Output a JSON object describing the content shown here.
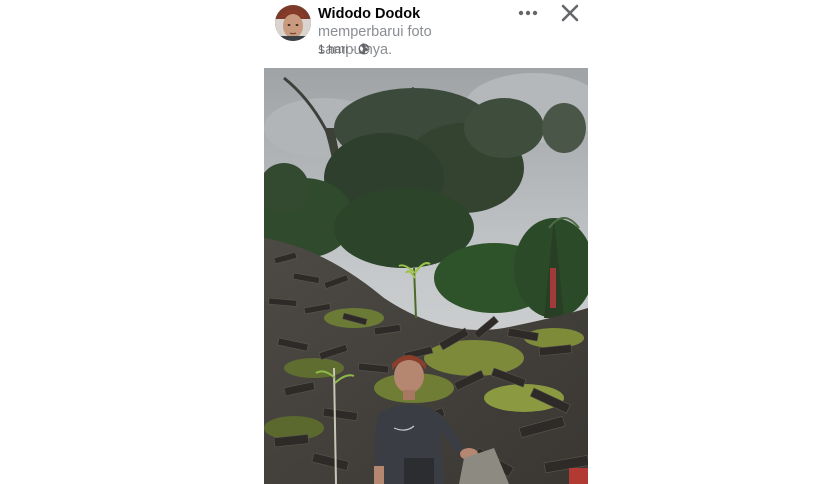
{
  "post": {
    "author": "Widodo Dodok",
    "action": "memperbarui foto sampulnya.",
    "time": "1 hari",
    "separator": "·"
  },
  "icons": {
    "avatar": "profile-avatar",
    "audience": "globe-icon",
    "more": "more-options-icon",
    "close": "close-icon"
  },
  "photo": {
    "subject": "cover-photo"
  },
  "colors": {
    "name": "#050505",
    "secondary": "#8a8d91",
    "meta": "#65676b",
    "icon": "#65676b"
  }
}
